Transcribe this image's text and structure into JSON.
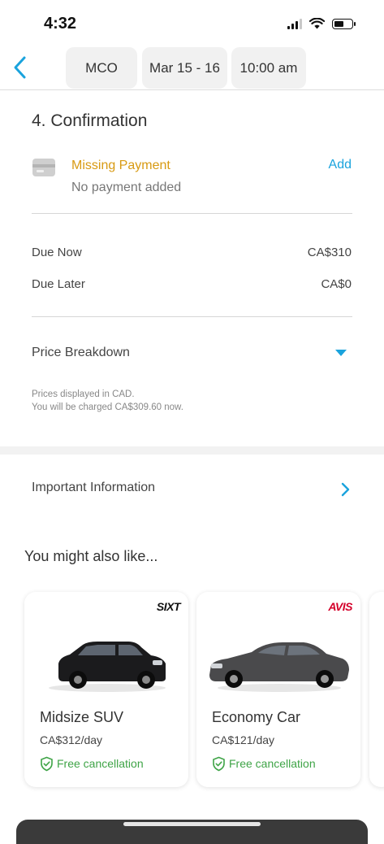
{
  "status_bar": {
    "time": "4:32"
  },
  "header": {
    "location": "MCO",
    "dates": "Mar 15 - 16",
    "time": "10:00 am"
  },
  "confirmation": {
    "title": "4. Confirmation",
    "payment_status": "Missing Payment",
    "payment_detail": "No payment added",
    "add_label": "Add",
    "status_color": "#d89a12",
    "accent": "#1aa3dd"
  },
  "pricing": {
    "rows": [
      {
        "label": "Due Now",
        "value": "CA$310"
      },
      {
        "label": "Due Later",
        "value": "CA$0"
      }
    ],
    "breakdown_label": "Price Breakdown",
    "notes": [
      "Prices displayed in CAD.",
      "You will be charged CA$309.60 now."
    ]
  },
  "important_info": {
    "label": "Important Information"
  },
  "suggestions": {
    "title": "You might also like...",
    "items": [
      {
        "brand": "SIXT",
        "brand_color": "#111111",
        "name": "Midsize SUV",
        "price": "CA$312/day",
        "badge": "Free cancellation",
        "car_color": "#1b1b1d",
        "icon": "suv-image"
      },
      {
        "brand": "AVIS",
        "brand_color": "#d4002a",
        "name": "Economy Car",
        "price": "CA$121/day",
        "badge": "Free cancellation",
        "car_color": "#4a4a4c",
        "icon": "sedan-image"
      }
    ]
  }
}
